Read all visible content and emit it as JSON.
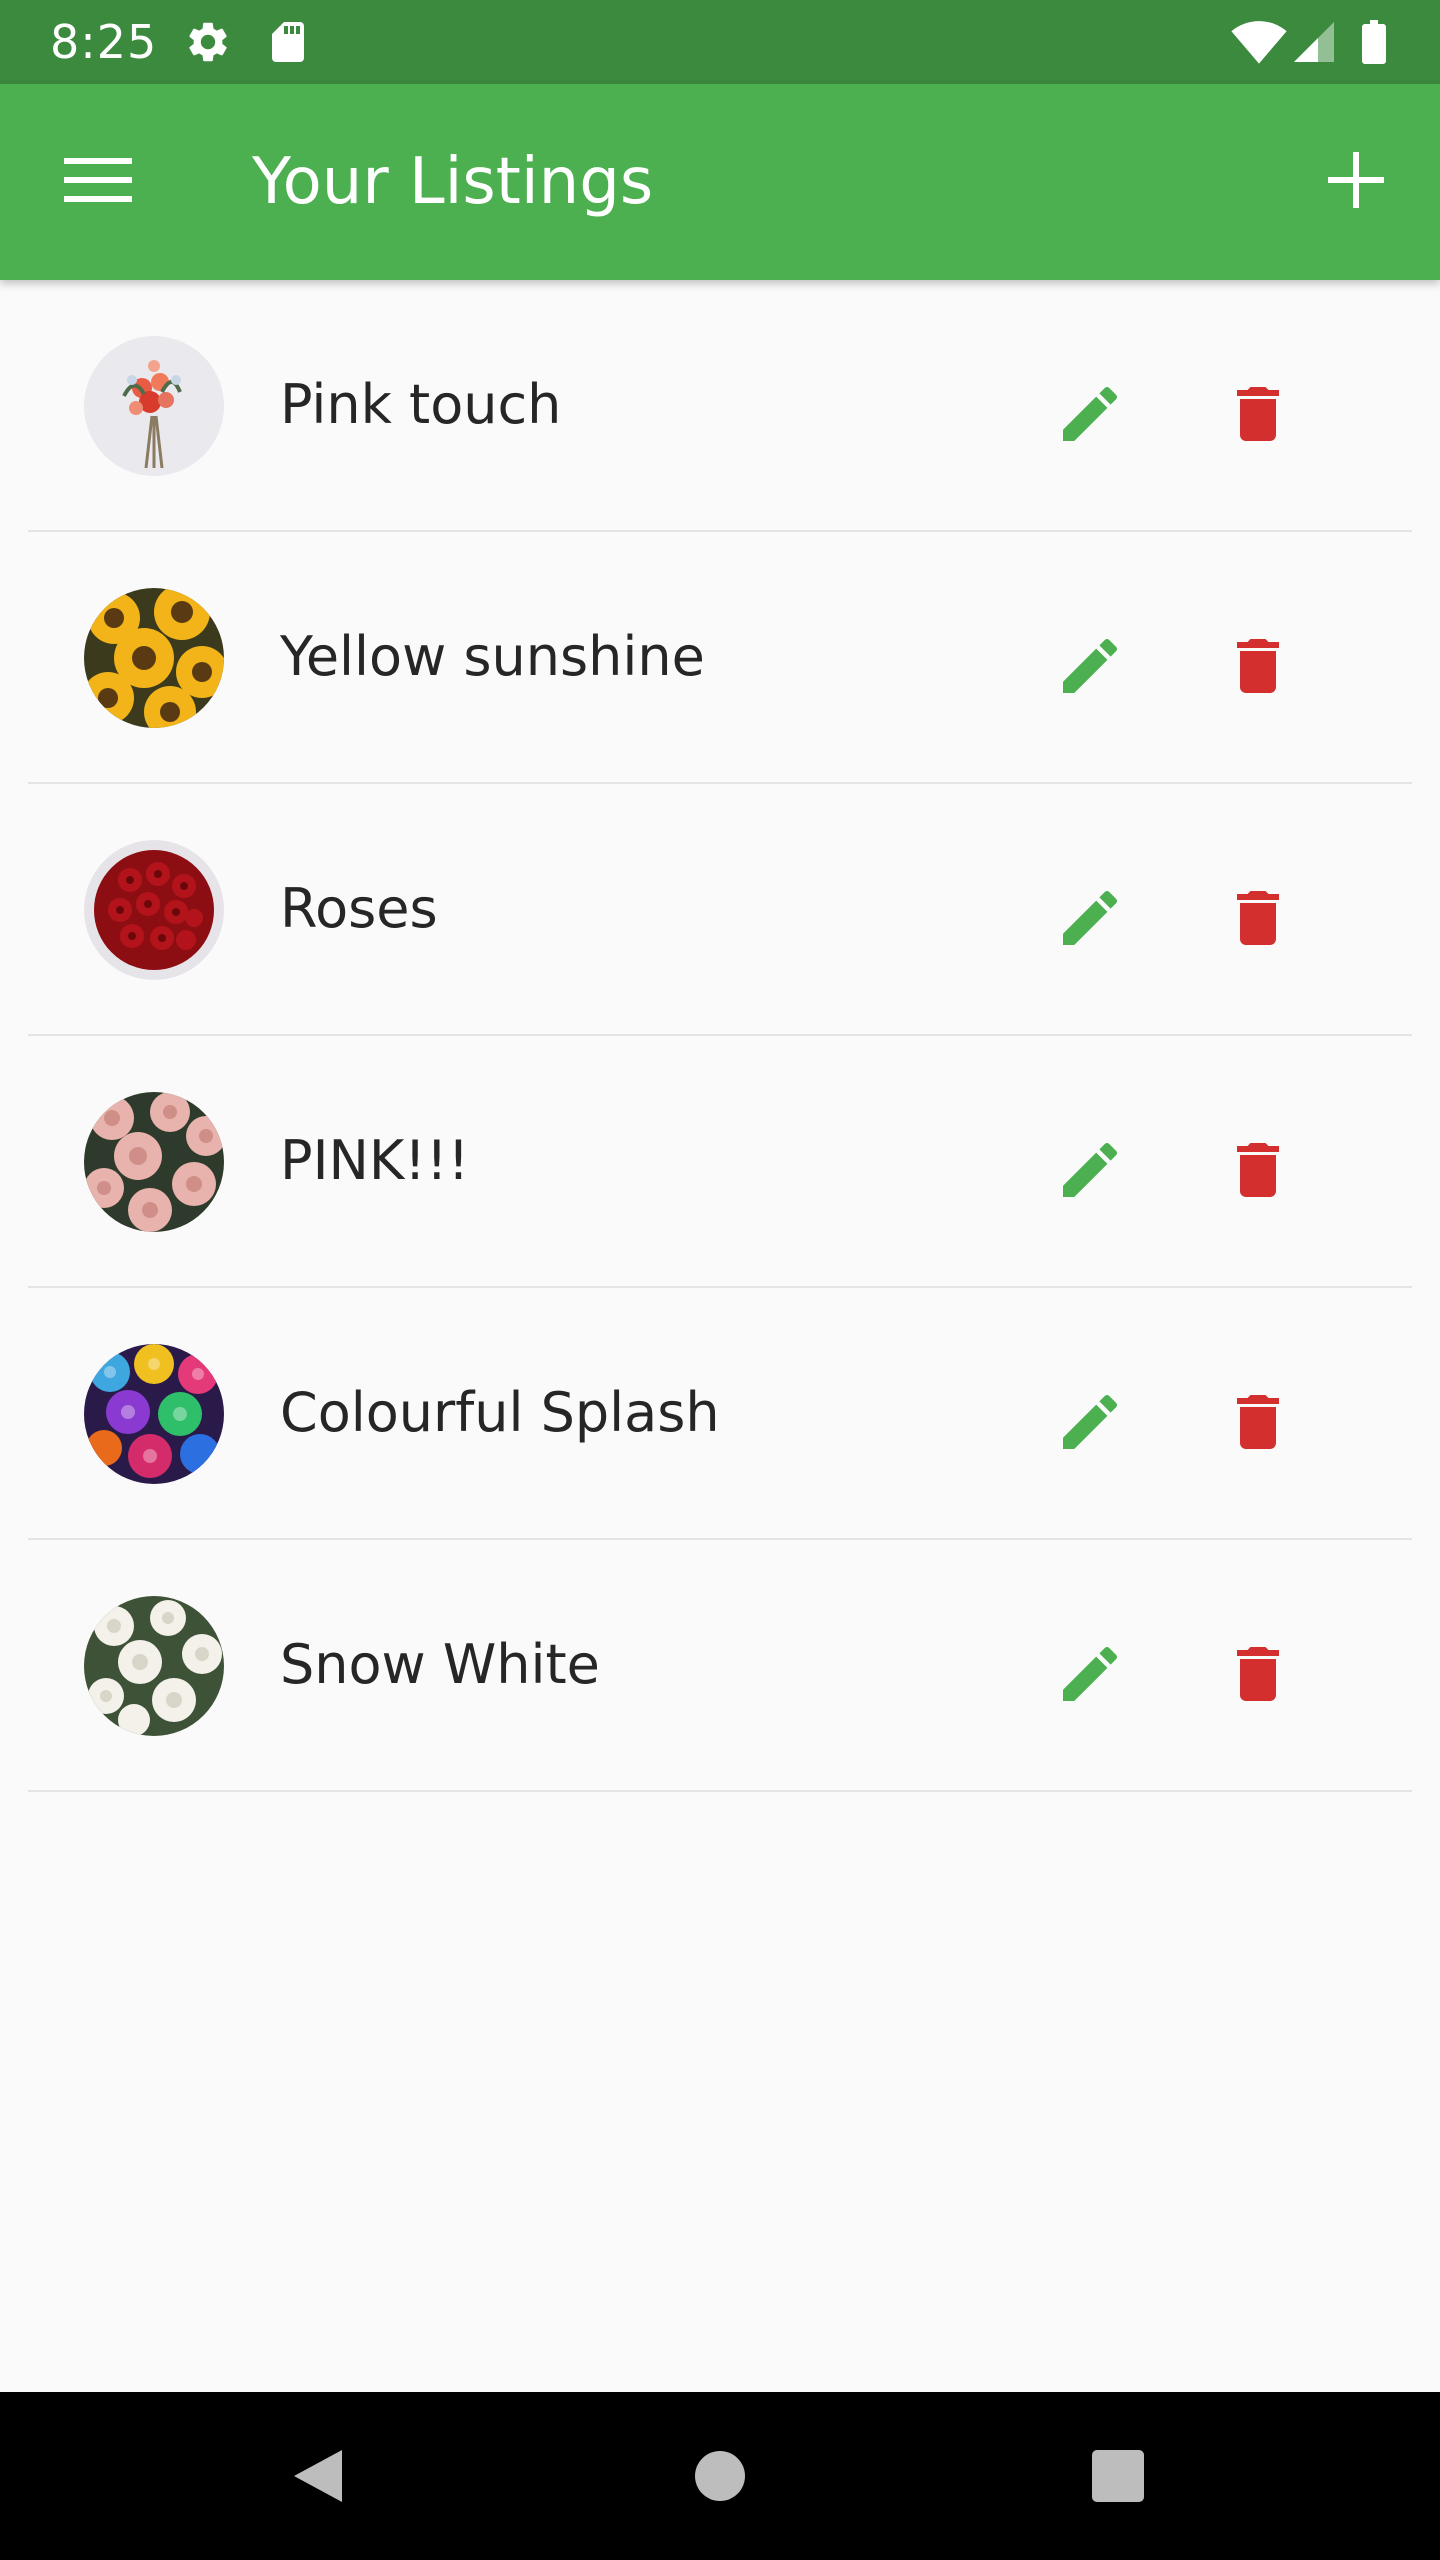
{
  "status_bar": {
    "time": "8:25",
    "icons": [
      "gear-icon",
      "sd-card-icon",
      "wifi-icon",
      "signal-icon",
      "battery-icon"
    ]
  },
  "app_bar": {
    "title": "Your Listings",
    "menu_icon": "menu-icon",
    "add_icon": "add-icon",
    "color": "#4caf50"
  },
  "listings": [
    {
      "name": "Pink touch",
      "thumbnail": "bouquet-white-background"
    },
    {
      "name": "Yellow sunshine",
      "thumbnail": "sunflowers"
    },
    {
      "name": "Roses",
      "thumbnail": "red-roses"
    },
    {
      "name": "PINK!!!",
      "thumbnail": "pink-roses"
    },
    {
      "name": "Colourful Splash",
      "thumbnail": "rainbow-roses"
    },
    {
      "name": "Snow White",
      "thumbnail": "white-roses"
    }
  ],
  "actions": {
    "edit_icon": "pencil-icon",
    "delete_icon": "trash-icon",
    "edit_color": "#4caf50",
    "delete_color": "#d32f2f"
  },
  "nav_bar": {
    "icons": [
      "back-icon",
      "home-icon",
      "recents-icon"
    ]
  }
}
